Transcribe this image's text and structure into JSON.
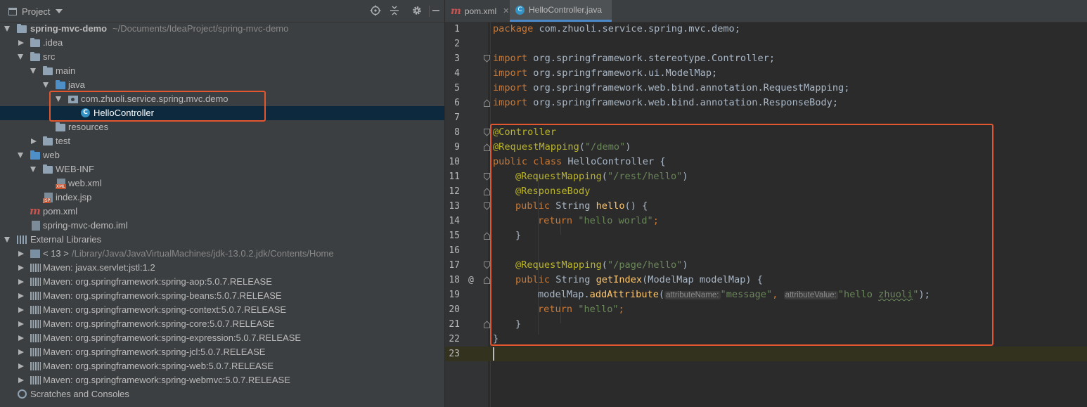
{
  "project_panel": {
    "title": "Project",
    "tree": [
      {
        "label": "spring-mvc-demo",
        "sub": "~/Documents/IdeaProject/spring-mvc-demo",
        "bold": true
      },
      {
        "label": ".idea"
      },
      {
        "label": "src"
      },
      {
        "label": "main"
      },
      {
        "label": "java"
      },
      {
        "label": "com.zhuoli.service.spring.mvc.demo"
      },
      {
        "label": "HelloController",
        "selected": true
      },
      {
        "label": "resources"
      },
      {
        "label": "test"
      },
      {
        "label": "web"
      },
      {
        "label": "WEB-INF"
      },
      {
        "label": "web.xml"
      },
      {
        "label": "index.jsp"
      },
      {
        "label": "pom.xml"
      },
      {
        "label": "spring-mvc-demo.iml"
      },
      {
        "label": "External Libraries"
      },
      {
        "label": "< 13 >",
        "sub": "/Library/Java/JavaVirtualMachines/jdk-13.0.2.jdk/Contents/Home"
      },
      {
        "label": "Maven: javax.servlet:jstl:1.2"
      },
      {
        "label": "Maven: org.springframework:spring-aop:5.0.7.RELEASE"
      },
      {
        "label": "Maven: org.springframework:spring-beans:5.0.7.RELEASE"
      },
      {
        "label": "Maven: org.springframework:spring-context:5.0.7.RELEASE"
      },
      {
        "label": "Maven: org.springframework:spring-core:5.0.7.RELEASE"
      },
      {
        "label": "Maven: org.springframework:spring-expression:5.0.7.RELEASE"
      },
      {
        "label": "Maven: org.springframework:spring-jcl:5.0.7.RELEASE"
      },
      {
        "label": "Maven: org.springframework:spring-web:5.0.7.RELEASE"
      },
      {
        "label": "Maven: org.springframework:spring-webmvc:5.0.7.RELEASE"
      },
      {
        "label": "Scratches and Consoles"
      }
    ]
  },
  "tabs": [
    {
      "label": "pom.xml",
      "icon": "maven-icon",
      "active": false
    },
    {
      "label": "HelloController.java",
      "icon": "class-icon",
      "active": true
    }
  ],
  "editor": {
    "line_numbers": [
      "1",
      "2",
      "3",
      "4",
      "5",
      "6",
      "7",
      "8",
      "9",
      "10",
      "11",
      "12",
      "13",
      "14",
      "15",
      "16",
      "17",
      "18",
      "19",
      "20",
      "21",
      "22",
      "23"
    ],
    "gutter_marker": "@",
    "hints": {
      "attributeName": "attributeName:",
      "attributeValue": "attributeValue:"
    },
    "tokens": {
      "l1_kw": "package",
      "l1_rest": " com.zhuoli.service.spring.mvc.demo;",
      "import_kw": "import",
      "l3_rest": " org.springframework.stereotype.Controller;",
      "l4_rest": " org.springframework.ui.ModelMap;",
      "l5_rest": " org.springframework.web.bind.annotation.RequestMapping;",
      "l6_rest": " org.springframework.web.bind.annotation.ResponseBody;",
      "l8_ann": "@Controller",
      "l9_ann": "@RequestMapping",
      "l9_open": "(",
      "l9_str": "\"/demo\"",
      "l9_close": ")",
      "l10_kw": "public class",
      "l10_rest": " HelloController {",
      "l11_ann": "@RequestMapping",
      "l11_open": "(",
      "l11_str": "\"/rest/hello\"",
      "l11_close": ")",
      "l12_ann": "@ResponseBody",
      "l13_kw": "public",
      "l13_type": " String ",
      "l13_fn": "hello",
      "l13_rest": "() {",
      "l14_kw": "return",
      "l14_str": " \"hello world\"",
      "l14_semi": ";",
      "l15": "}",
      "l17_ann": "@RequestMapping",
      "l17_open": "(",
      "l17_str": "\"/page/hello\"",
      "l17_close": ")",
      "l18_kw": "public",
      "l18_type": " String ",
      "l18_fn": "getIndex",
      "l18_rest": "(ModelMap modelMap) {",
      "l19_a": "modelMap.",
      "l19_fn": "addAttribute",
      "l19_open": "(",
      "l19_str1": "\"message\"",
      "l19_comma": ", ",
      "l19_str2a": "\"hello ",
      "l19_str2b": "zhuoli",
      "l19_str2c": "\"",
      "l19_close": ");",
      "l20_kw": "return",
      "l20_str": " \"hello\"",
      "l20_semi": ";",
      "l21": "}",
      "l22": "}"
    }
  }
}
